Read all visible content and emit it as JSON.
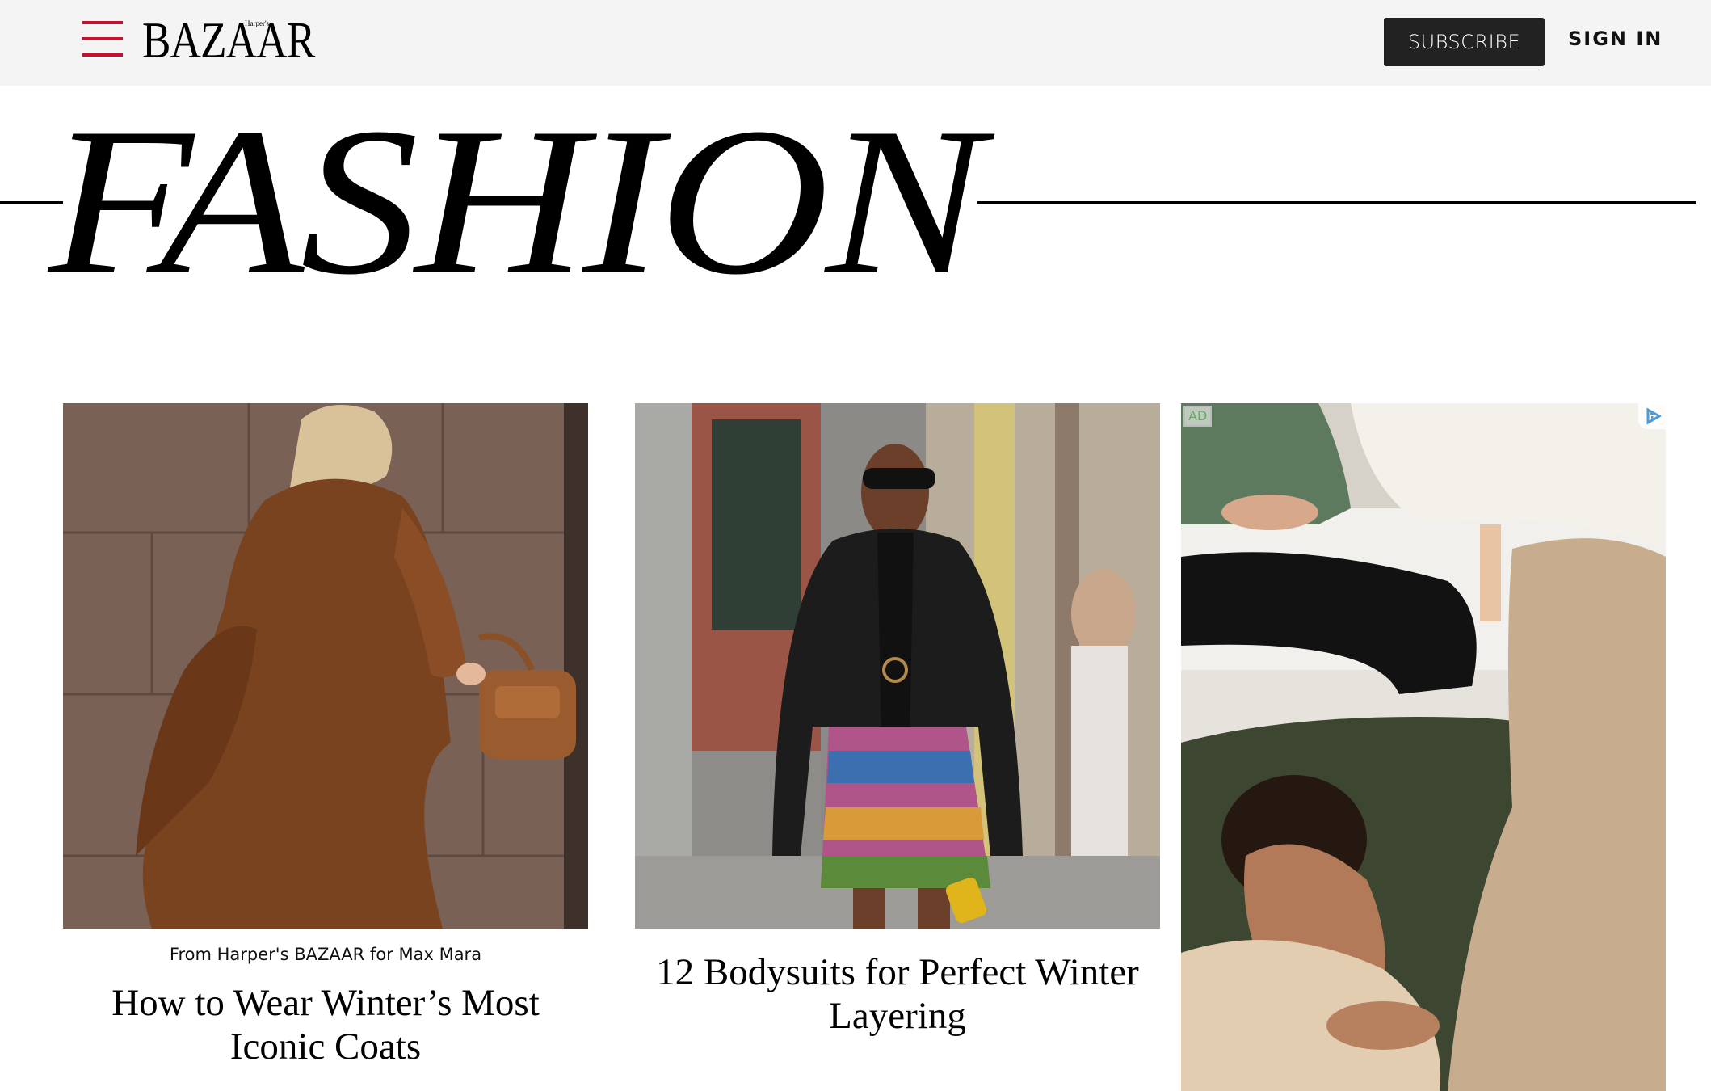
{
  "header": {
    "logo_small": "Harper's",
    "logo_text": "BAZAAR",
    "subscribe_label": "SUBSCRIBE",
    "signin_label": "SIGN IN",
    "colors": {
      "background": "#f4f4f4",
      "menu_icon": "#c8102e",
      "subscribe_bg": "#222222"
    }
  },
  "section": {
    "title": "FASHION"
  },
  "articles": [
    {
      "sponsor": "From Harper's BAZAAR for Max Mara",
      "title_line1": "How to Wear Winter’s Most",
      "title_line2": "Iconic Coats",
      "image_desc": "woman-in-camel-coat-with-brown-bag"
    },
    {
      "title_line1": "12 Bodysuits for Perfect Winter",
      "title_line2": "Layering",
      "image_desc": "woman-in-leather-jacket-and-patterned-skirt"
    }
  ],
  "ad": {
    "label": "AD",
    "image_desc": "two-people-relaxing-on-sofa-in-knitwear"
  }
}
